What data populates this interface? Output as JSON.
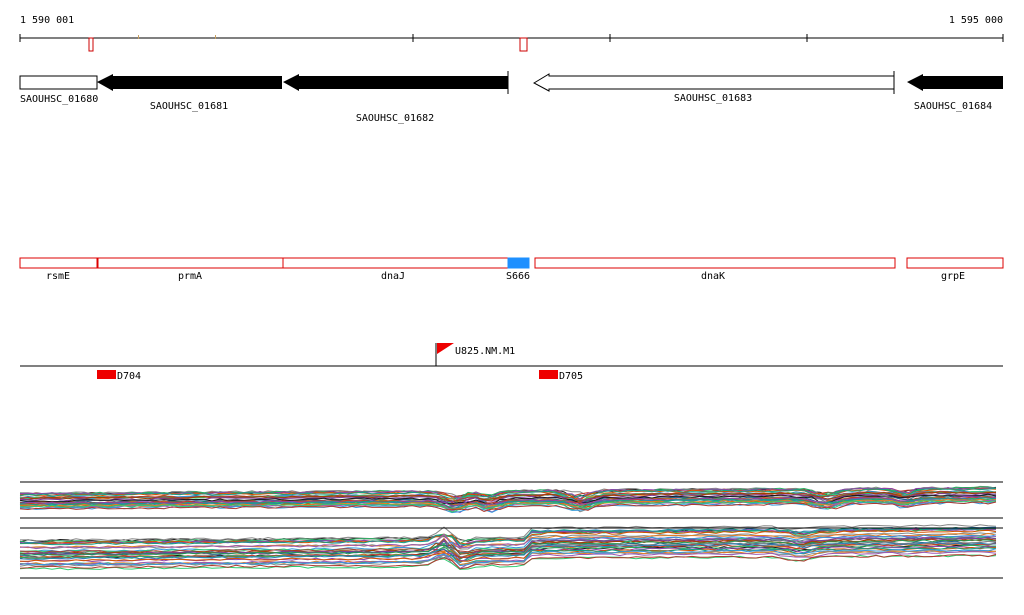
{
  "ruler": {
    "start_label": "1 590 001",
    "end_label": "1 595 000"
  },
  "genes": [
    {
      "name": "SAOUHSC_01680",
      "strand": "plus",
      "fill": "#ffffff"
    },
    {
      "name": "SAOUHSC_01681",
      "strand": "minus",
      "fill": "#000000"
    },
    {
      "name": "SAOUHSC_01682",
      "strand": "minus",
      "fill": "#000000"
    },
    {
      "name": "SAOUHSC_01683",
      "strand": "minus",
      "fill": "#ffffff"
    },
    {
      "name": "SAOUHSC_01684",
      "strand": "minus",
      "fill": "#000000"
    }
  ],
  "features": [
    {
      "name": "rsmE"
    },
    {
      "name": "prmA"
    },
    {
      "name": "dnaJ"
    },
    {
      "name": "S666"
    },
    {
      "name": "dnaK"
    },
    {
      "name": "grpE"
    }
  ],
  "markers": {
    "flag": {
      "label": "U825.NM.M1"
    },
    "blocks": [
      {
        "label": "D704"
      },
      {
        "label": "D705"
      }
    ]
  },
  "colors": {
    "feature_outline": "#dd0000",
    "highlight": "#1e90ff",
    "marker": "#ee0000",
    "gene_fill": "#000000"
  }
}
